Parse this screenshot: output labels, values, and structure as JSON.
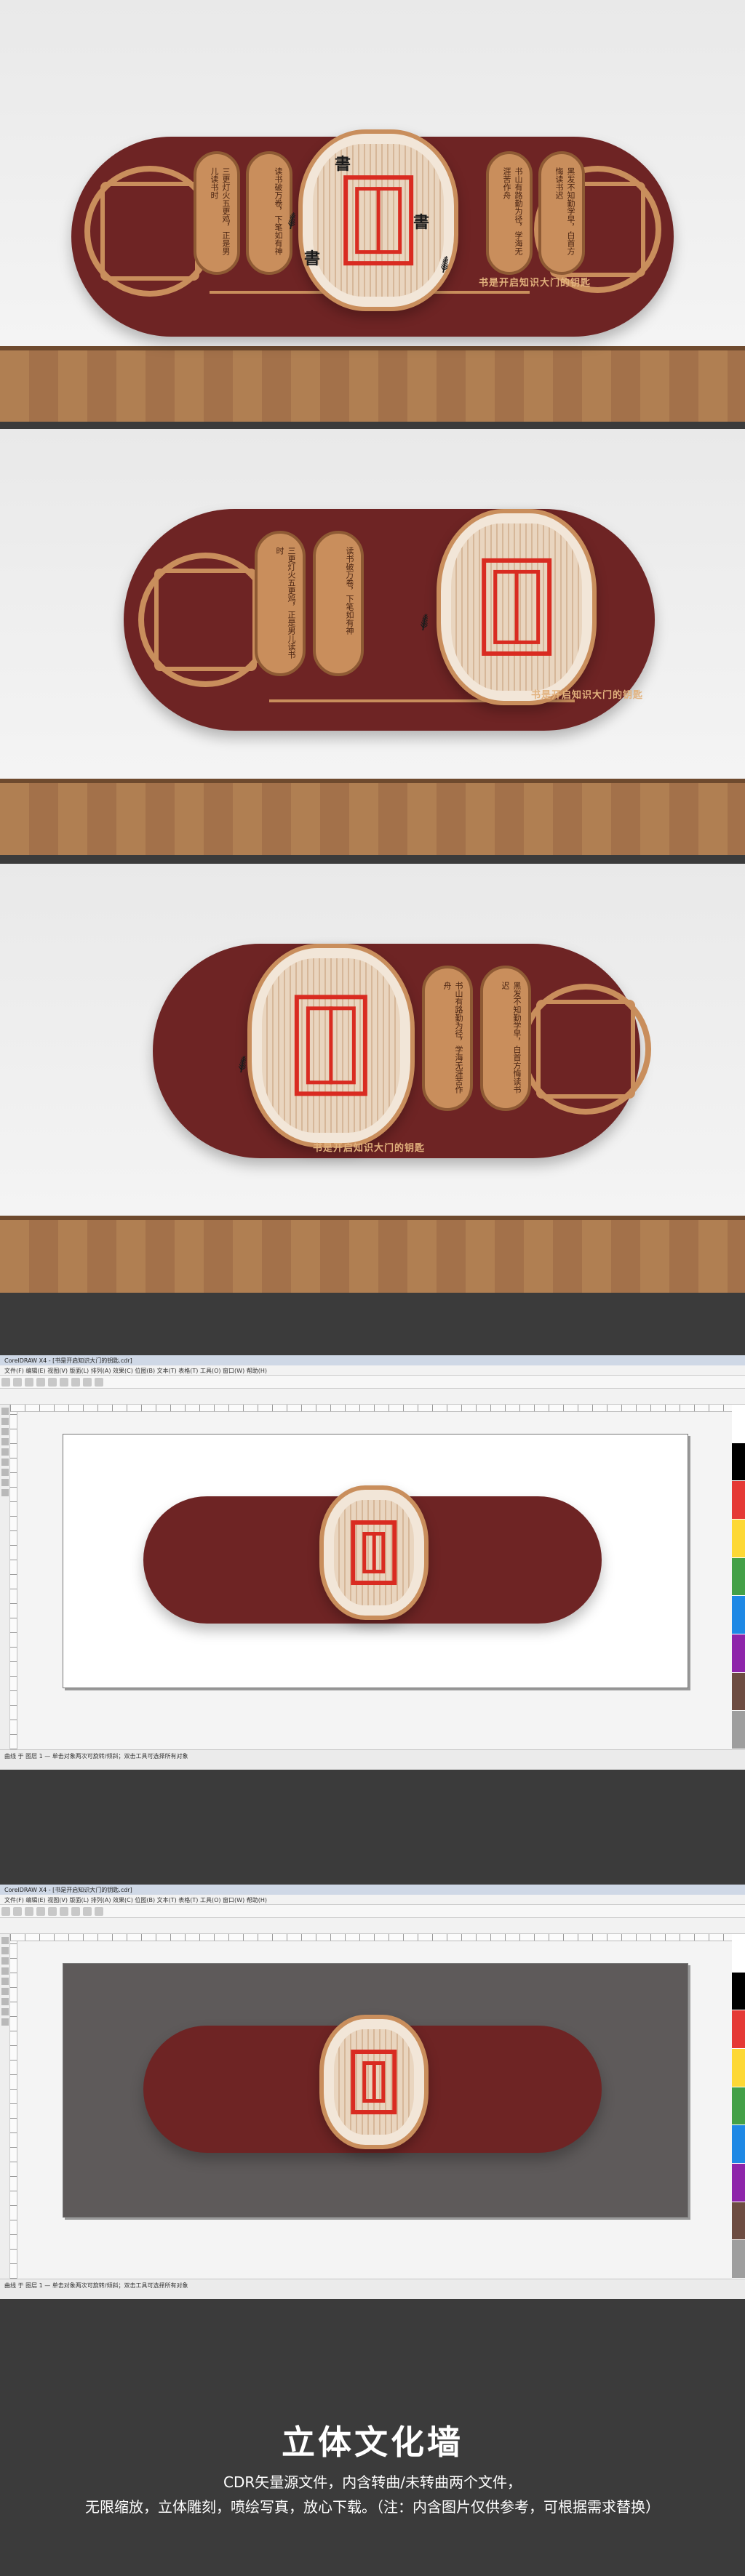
{
  "wall": {
    "motto": "书是开启知识大门的钥匙",
    "character": "書",
    "plaque_texts": [
      "三更灯火五更鸡，正是男儿读书时",
      "读书破万卷，下笔如有神",
      "书山有路勤为径，学海无涯苦作舟",
      "黑发不知勤学早，白首方悔读书迟"
    ],
    "colors": {
      "main": "#6e2424",
      "accent": "#c98e5c",
      "seal": "#d92b21"
    }
  },
  "cdr": {
    "title_text": "CorelDRAW X4 - [书是开启知识大门的钥匙.cdr]",
    "menu_text": "文件(F)  编辑(E)  视图(V)  版面(L)  排列(A)  效果(C)  位图(B)  文本(T)  表格(T)  工具(O)  窗口(W)  帮助(H)",
    "status_text": "曲线 于 图层 1 — 单击对象两次可旋转/倾斜；双击工具可选择所有对象"
  },
  "footer": {
    "title": "立体文化墙",
    "line1": "CDR矢量源文件，内含转曲/未转曲两个文件，",
    "line2": "无限缩放，立体雕刻，喷绘写真，放心下载。（注：内含图片仅供参考，可根据需求替换）"
  }
}
